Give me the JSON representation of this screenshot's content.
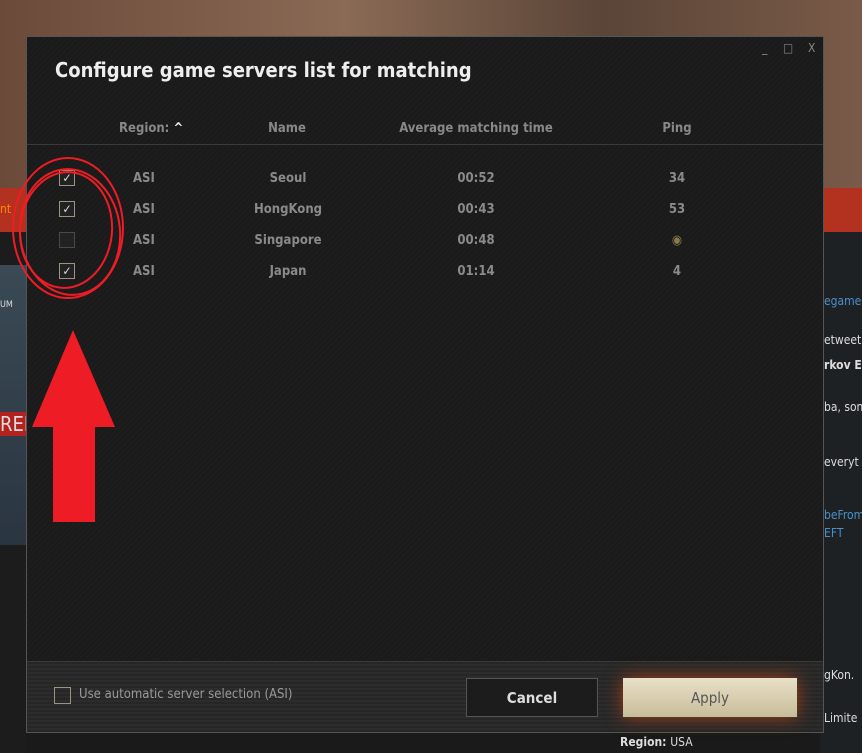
{
  "dialog": {
    "title": "Configure game servers list for matching",
    "window_controls": {
      "minimize": "_",
      "maximize": "□",
      "close": "X"
    }
  },
  "table": {
    "headers": {
      "region": "Region:",
      "name": "Name",
      "time": "Average matching time",
      "ping": "Ping"
    },
    "sort_icon": "chevron-up-icon",
    "rows": [
      {
        "checked": true,
        "region": "ASI",
        "name": "Seoul",
        "time": "00:52",
        "ping": "34"
      },
      {
        "checked": true,
        "region": "ASI",
        "name": "HongKong",
        "time": "00:43",
        "ping": "53"
      },
      {
        "checked": false,
        "region": "ASI",
        "name": "Singapore",
        "time": "00:48",
        "ping": ""
      },
      {
        "checked": true,
        "region": "ASI",
        "name": "Japan",
        "time": "01:14",
        "ping": "4"
      }
    ]
  },
  "footer": {
    "auto_label": "Use automatic server selection (ASI)",
    "auto_checked": false,
    "cancel": "Cancel",
    "apply": "Apply"
  },
  "background": {
    "left": [
      "nt",
      "UM",
      "RED"
    ],
    "right": [
      "egame",
      "etweet",
      "rkov E",
      "ba, som",
      "everyt",
      "beFrom",
      "EFT",
      "gKon.",
      "Limite"
    ],
    "region_label": "Region:",
    "region_value": "USA"
  },
  "colors": {
    "annotation": "#ee1c25",
    "accent_red": "#b3321f"
  }
}
